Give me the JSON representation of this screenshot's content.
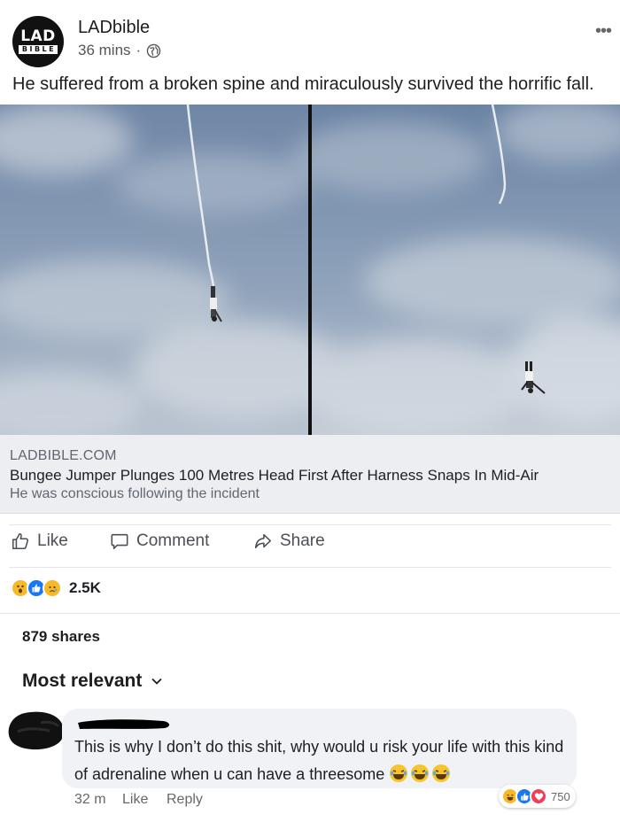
{
  "post": {
    "page_name": "LADbible",
    "time": "36 mins",
    "meta_sep": "·",
    "logo_top": "LAD",
    "logo_bottom": "BIBLE",
    "more_icon": "more-dots-icon",
    "text": "He suffered from a broken spine and miraculously survived the horrific fall."
  },
  "link": {
    "domain": "LADBIBLE.COM",
    "title": "Bungee Jumper Plunges 100 Metres Head First After Harness Snaps In Mid-Air",
    "description": "He was conscious following the incident"
  },
  "actions": {
    "like": "Like",
    "comment": "Comment",
    "share": "Share"
  },
  "stats": {
    "reaction_count": "2.5K",
    "reactions": [
      "wow",
      "like",
      "sad"
    ],
    "shares": "879 shares"
  },
  "comments": {
    "sort_label": "Most relevant",
    "items": [
      {
        "text": "This is why I don’t do this shit, why would u risk your life with this kind of adrenaline when u can have a threesome",
        "time": "32 m",
        "like": "Like",
        "reply": "Reply",
        "reaction_count": "750",
        "reactions": [
          "haha",
          "like",
          "love"
        ]
      }
    ]
  },
  "colors": {
    "facebook_blue": "#1877f2",
    "reaction_yellow": "#f7b928",
    "love_red": "#f33e58",
    "link_bg": "#eceef1"
  }
}
